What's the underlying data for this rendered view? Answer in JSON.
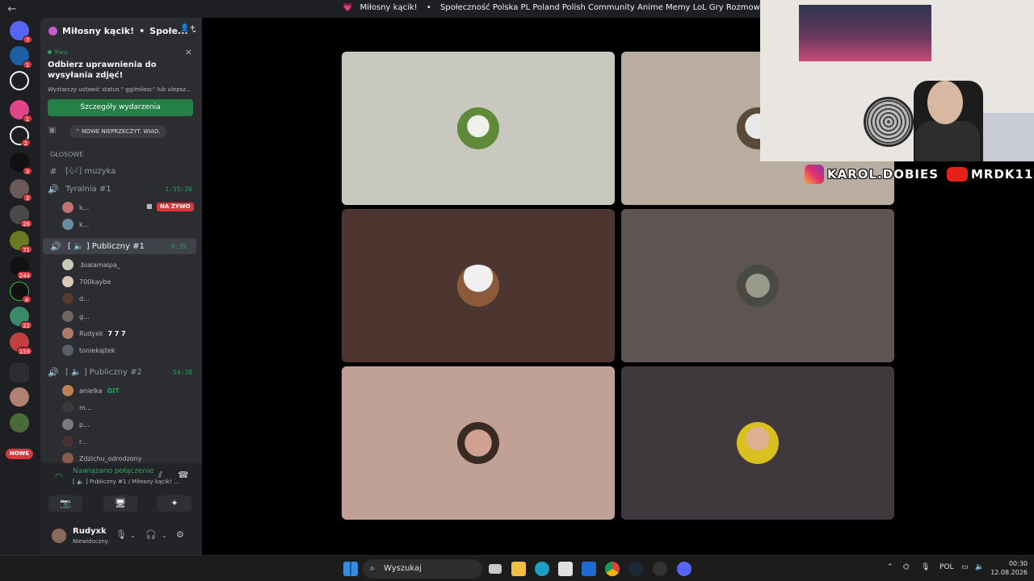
{
  "window": {
    "title_heart": "💗",
    "title_channel": "Miłosny kącik!",
    "title_sep": "•",
    "title_server": "Społeczność Polska PL Poland Polish Community Anime Memy LoL Gry Rozmowy RP",
    "back": "←"
  },
  "rail": {
    "badges": [
      "7",
      "1",
      "1",
      "2",
      "3",
      "3",
      "1",
      "26",
      "71",
      "244",
      "4",
      "22",
      "159"
    ],
    "nowe": "NOWE"
  },
  "sidebar": {
    "server_name": "Miłosny kącik!",
    "dot": "•",
    "server_short": "Społe...",
    "chevron": "⌄",
    "invite_icon": "👤+",
    "event": {
      "status": "Trwa",
      "close": "×",
      "title": "Odbierz uprawnienia do wysyłania zdjęć!",
      "desc": "Wystarczy ustawić status \" gg/milosc\" lub ulepsz...",
      "button": "Szczegóły wydarzenia"
    },
    "new_unread": "⌃ NOWE NIEPRZECZYT. WIAD.",
    "category": "GŁOSOWE",
    "channels": [
      {
        "name": "[🎶] muzyka",
        "icon": "#"
      },
      {
        "name": "Tyralnia #1",
        "time": "1:55:26"
      },
      {
        "name": "[ 🔈 ] Publiczny #1",
        "time": "8:35"
      },
      {
        "name": "[ 🔈 ] Publiczny #2",
        "time": "54:38"
      }
    ],
    "tyralnia_members": [
      "k...",
      "k..."
    ],
    "live": "NA ŻYWO",
    "pub1_members": [
      ".bialamalpa_",
      "700kaybe",
      "d...",
      "g...",
      "Rudyxk",
      "toniekajtek"
    ],
    "rudyxk_tag": "7 7 7",
    "pub2_members": [
      "anielka",
      "m...",
      "p...",
      "r...",
      "Zdzichu_odrodzony"
    ],
    "anielka_tag": "GIT"
  },
  "voice": {
    "status": "Nawiązano połączenie",
    "sub": "[ 🔈 ] Publiczny #1 / Miłosny kącik! ...",
    "btn_camera": "📷",
    "btn_share": "🖥",
    "btn_activities": "✦"
  },
  "user": {
    "name": "Rudyxk",
    "status": "Niewidoczny",
    "mic": "🎙",
    "headset": "🎧",
    "settings": "⚙"
  },
  "overlay": {
    "instagram": "KAROL.DOBIES",
    "youtube": "MRDK11"
  },
  "taskbar": {
    "search": "Wyszukaj",
    "search_icon": "⌕",
    "lang": "POL",
    "time": "00:30",
    "date": "12.08.2026"
  },
  "colors": {
    "tiles": [
      "#c8c8bf",
      "#b9ada2",
      "#4e3630",
      "#5e5451",
      "#c1a096",
      "#3f393d"
    ],
    "green": "#23a55a",
    "red": "#da373c"
  }
}
